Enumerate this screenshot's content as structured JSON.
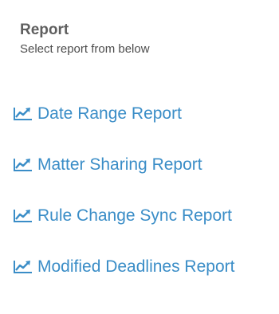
{
  "colors": {
    "link": "#3a8dc7",
    "title": "#5f5f5f",
    "subtitle": "#4d4d4d",
    "background": "#ffffff"
  },
  "report": {
    "title": "Report",
    "subtitle": "Select report from below",
    "items": [
      {
        "label": "Date Range Report",
        "icon": "line-chart-icon"
      },
      {
        "label": "Matter Sharing Report",
        "icon": "line-chart-icon"
      },
      {
        "label": "Rule Change Sync Report",
        "icon": "line-chart-icon"
      },
      {
        "label": "Modified Deadlines Report",
        "icon": "line-chart-icon"
      }
    ]
  }
}
